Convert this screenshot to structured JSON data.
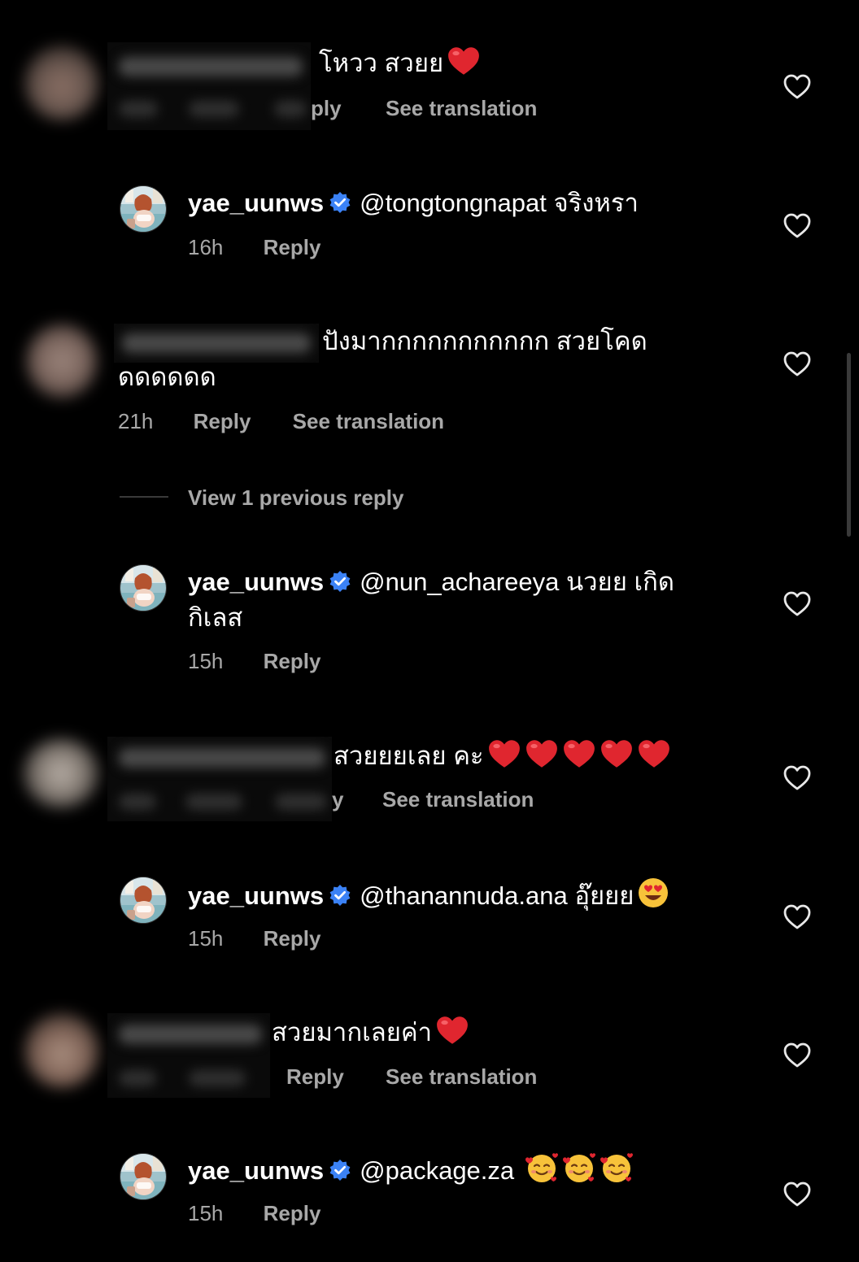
{
  "comments": [
    {
      "id": "c1",
      "text": "โหวว สวยย",
      "meta_visible": [
        "Reply",
        "See translation"
      ]
    },
    {
      "id": "r1",
      "username": "yae_uunws",
      "text": "@tongtongnapat จริงหรา",
      "time": "16h",
      "reply": "Reply"
    },
    {
      "id": "c2",
      "text_line1": "ปังมากกกกกกกกกกก สวยโคด",
      "text_line2": "ดดดดดด",
      "time": "21h",
      "reply": "Reply",
      "see_translation": "See translation"
    },
    {
      "id": "view_more",
      "label": "View 1 previous reply"
    },
    {
      "id": "r2",
      "username": "yae_uunws",
      "text_line1": "@nun_achareeya นวยย เกิด",
      "text_line2": "กิเลส",
      "time": "15h",
      "reply": "Reply"
    },
    {
      "id": "c3",
      "text": "สวยยยเลย คะ",
      "see_translation": "See translation"
    },
    {
      "id": "r3",
      "username": "yae_uunws",
      "text": "@thanannuda.ana อุ๊ยยย",
      "time": "15h",
      "reply": "Reply"
    },
    {
      "id": "c4",
      "text": "สวยมากเลยค่า",
      "reply": "Reply",
      "see_translation": "See translation"
    },
    {
      "id": "r4",
      "username": "yae_uunws",
      "text": "@package.za",
      "time": "15h",
      "reply": "Reply"
    }
  ],
  "partial_labels": {
    "c1_reply_fragment": "ply",
    "c3_reply_fragment": "y"
  },
  "colors": {
    "background": "#000000",
    "secondary_text": "#a8a8a8",
    "verified": "#3b82f6",
    "heart_emoji": "#e0262f"
  },
  "icons": {
    "like": "heart-outline-icon",
    "verified": "verified-badge-icon"
  }
}
